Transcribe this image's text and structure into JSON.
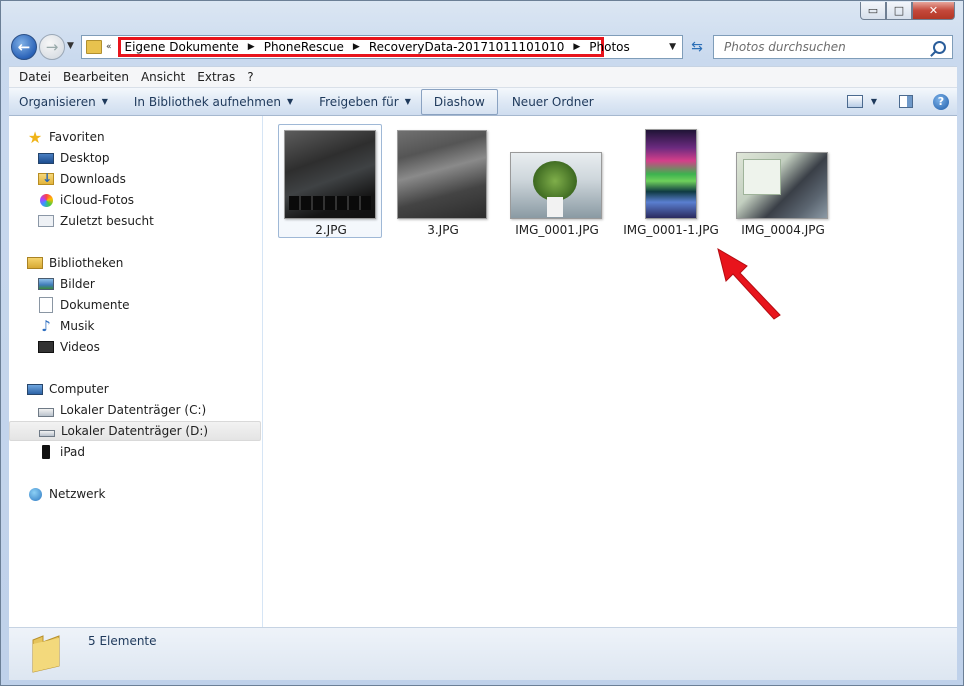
{
  "window": {
    "caption_buttons": {
      "minimize": "▭",
      "maximize": "□",
      "close": "✕"
    }
  },
  "navigation": {
    "back_glyph": "←",
    "forward_glyph": "→",
    "breadcrumb_overflow": "«",
    "breadcrumb": [
      "Eigene Dokumente",
      "PhoneRescue",
      "RecoveryData-20171011101010",
      "Photos"
    ],
    "search_placeholder": "Photos durchsuchen"
  },
  "menubar": [
    "Datei",
    "Bearbeiten",
    "Ansicht",
    "Extras",
    "?"
  ],
  "toolbar": {
    "organize": "Organisieren",
    "library": "In Bibliothek aufnehmen",
    "share": "Freigeben für",
    "slideshow": "Diashow",
    "new_folder": "Neuer Ordner",
    "help": "?"
  },
  "sidebar": {
    "favorites": {
      "label": "Favoriten",
      "items": [
        "Desktop",
        "Downloads",
        "iCloud-Fotos",
        "Zuletzt besucht"
      ]
    },
    "libraries": {
      "label": "Bibliotheken",
      "items": [
        "Bilder",
        "Dokumente",
        "Musik",
        "Videos"
      ]
    },
    "computer": {
      "label": "Computer",
      "items": [
        "Lokaler Datenträger (C:)",
        "Lokaler Datenträger (D:)",
        "iPad"
      ],
      "selected": "Lokaler Datenträger (D:)"
    },
    "network": {
      "label": "Netzwerk"
    }
  },
  "files": [
    {
      "name": "2.JPG",
      "selected": true
    },
    {
      "name": "3.JPG",
      "selected": false
    },
    {
      "name": "IMG_0001.JPG",
      "selected": false
    },
    {
      "name": "IMG_0001-1.JPG",
      "selected": false
    },
    {
      "name": "IMG_0004.JPG",
      "selected": false
    }
  ],
  "status": {
    "item_count": "5 Elemente"
  },
  "colors": {
    "highlight_box": "#e8141c",
    "annotation_arrow": "#e8141c",
    "link_text": "#1e395b"
  }
}
